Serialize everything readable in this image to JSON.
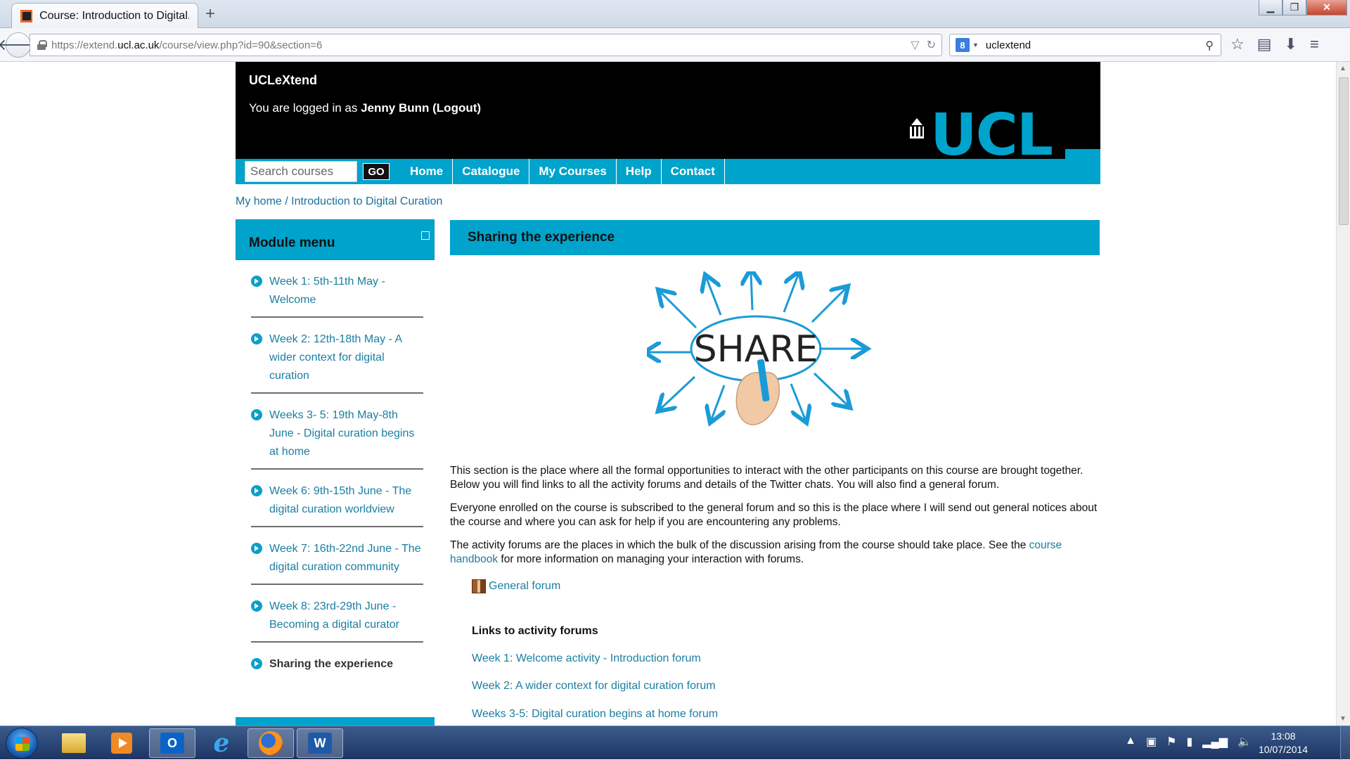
{
  "browser": {
    "tab_title": "Course: Introduction to Digital...",
    "new_tab": "+",
    "url_prefix": "https://extend.",
    "url_host": "ucl.ac.uk",
    "url_path": "/course/view.php?id=90&section=6",
    "search_value": "uclextend",
    "search_engine_badge": "8"
  },
  "site": {
    "name": "UCLeXtend",
    "login_prefix": "You are logged in as ",
    "user_name": "Jenny Bunn",
    "logout_label": "(Logout)",
    "logo_text": "UCL",
    "brand_color": "#00a3cc"
  },
  "nav": {
    "search_placeholder": "Search courses",
    "go_label": "GO",
    "links": [
      "Home",
      "Catalogue",
      "My Courses",
      "Help",
      "Contact"
    ]
  },
  "breadcrumb": {
    "home": "My home",
    "separator": " / ",
    "course": "Introduction to Digital Curation"
  },
  "module_menu": {
    "title": "Module menu",
    "items": [
      {
        "label": "Week 1: 5th-11th May - Welcome"
      },
      {
        "label": "Week 2: 12th-18th May - A wider context for digital curation"
      },
      {
        "label": "Weeks 3- 5: 19th May-8th June - Digital curation begins at home"
      },
      {
        "label": "Week 6: 9th-15th June - The digital curation worldview"
      },
      {
        "label": "Week 7: 16th-22nd June - The digital curation community"
      },
      {
        "label": "Week 8: 23rd-29th June - Becoming a digital curator"
      },
      {
        "label": "Sharing the experience",
        "current": true
      }
    ]
  },
  "section": {
    "title": "Sharing the experience",
    "image_word": "SHARE",
    "para1": "This section is the place where all the formal opportunities to interact with the other participants on this course are brought together. Below you will find links to all the activity forums and details of the Twitter chats. You will also find a general forum.",
    "para2": "Everyone enrolled on the course is subscribed to the general forum and so this is the place where I will send out general notices about the course and where you can ask for help if you are encountering any problems.",
    "para3_before": "The activity forums are the places in which the bulk of the discussion arising from the course should take place. See the ",
    "para3_link": "course handbook",
    "para3_after": " for more information on managing your interaction with forums.",
    "general_forum": "General forum",
    "links_heading": "Links to activity forums",
    "activity_links": [
      "Week 1: Welcome activity - Introduction forum",
      "Week 2: A wider context for digital curation forum",
      "Weeks 3-5: Digital curation begins at home forum"
    ]
  },
  "taskbar": {
    "time": "13:08",
    "date": "10/07/2014"
  }
}
